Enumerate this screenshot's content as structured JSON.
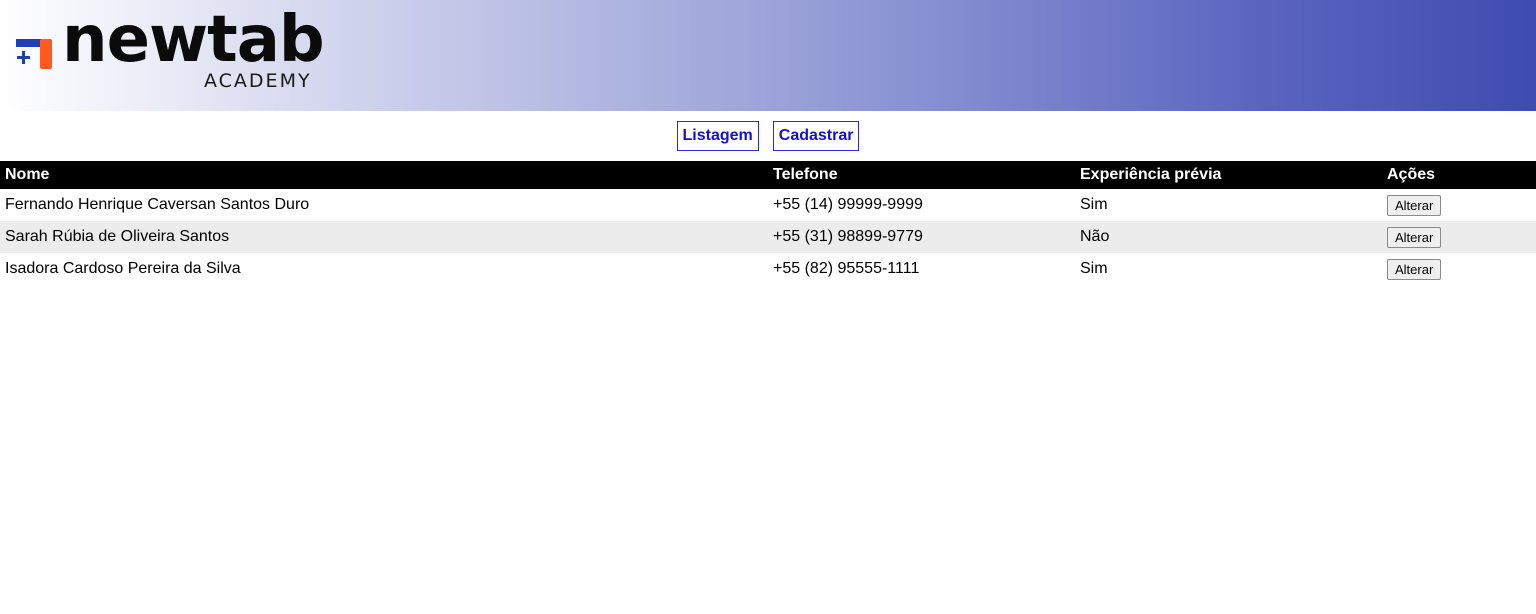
{
  "brand": {
    "name": "newtab",
    "sub": "ACADEMY",
    "logo_colors": [
      "#1e3fb5",
      "#ff5a1f"
    ]
  },
  "nav": {
    "items": [
      {
        "label": "Listagem"
      },
      {
        "label": "Cadastrar"
      }
    ]
  },
  "table": {
    "headers": {
      "nome": "Nome",
      "telefone": "Telefone",
      "experiencia": "Experiência prévia",
      "acoes": "Ações"
    },
    "rows": [
      {
        "nome": "Fernando Henrique Caversan Santos Duro",
        "telefone": "+55 (14) 99999-9999",
        "experiencia": "Sim",
        "action": "Alterar"
      },
      {
        "nome": "Sarah Rúbia de Oliveira Santos",
        "telefone": "+55 (31) 98899-9779",
        "experiencia": "Não",
        "action": "Alterar"
      },
      {
        "nome": "Isadora Cardoso Pereira da Silva",
        "telefone": "+55 (82) 95555-1111",
        "experiencia": "Sim",
        "action": "Alterar"
      }
    ]
  }
}
